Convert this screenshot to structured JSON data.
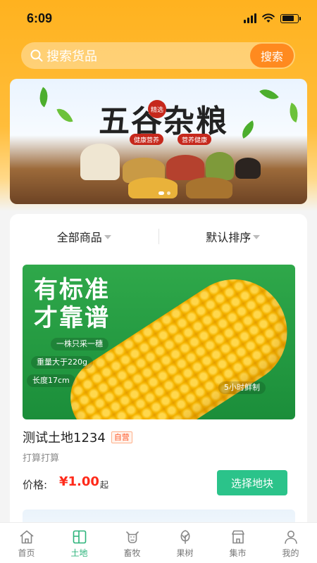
{
  "status_bar": {
    "time": "6:09"
  },
  "search": {
    "placeholder": "搜索货品",
    "button_label": "搜索"
  },
  "banner": {
    "title": "五谷杂粮",
    "seal_text": "精选",
    "tags": [
      "健康营养",
      "营养健康"
    ]
  },
  "filters": [
    {
      "label": "全部商品"
    },
    {
      "label": "默认排序"
    }
  ],
  "product": {
    "image_headline_1": "有标准",
    "image_headline_2": "才靠谱",
    "image_tags": [
      "一株只采一穗",
      "重量大于220g",
      "长度17cm",
      "5小时鲜制"
    ],
    "title": "测试土地1234",
    "badge": "自营",
    "description": "打算打算",
    "price_label": "价格:",
    "price": "¥1.00",
    "price_unit": "起",
    "action_label": "选择地块"
  },
  "tabs": [
    {
      "label": "首页",
      "icon": "home-icon",
      "active": false
    },
    {
      "label": "土地",
      "icon": "land-icon",
      "active": true
    },
    {
      "label": "畜牧",
      "icon": "livestock-icon",
      "active": false
    },
    {
      "label": "果树",
      "icon": "fruit-tree-icon",
      "active": false
    },
    {
      "label": "集市",
      "icon": "market-icon",
      "active": false
    },
    {
      "label": "我的",
      "icon": "profile-icon",
      "active": false
    }
  ],
  "colors": {
    "header_orange": "#ffb21f",
    "search_button": "#ff8a1f",
    "accent_green": "#2bc38a",
    "price_red": "#ff2a1a"
  }
}
